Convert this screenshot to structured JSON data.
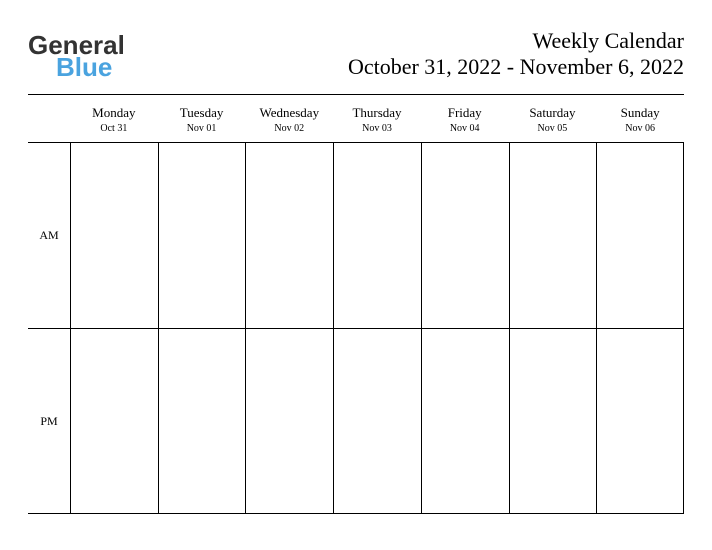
{
  "brand": {
    "word1": "General",
    "word2": "Blue"
  },
  "title": "Weekly Calendar",
  "date_range": "October 31, 2022 - November 6, 2022",
  "days": [
    {
      "name": "Monday",
      "date": "Oct 31"
    },
    {
      "name": "Tuesday",
      "date": "Nov 01"
    },
    {
      "name": "Wednesday",
      "date": "Nov 02"
    },
    {
      "name": "Thursday",
      "date": "Nov 03"
    },
    {
      "name": "Friday",
      "date": "Nov 04"
    },
    {
      "name": "Saturday",
      "date": "Nov 05"
    },
    {
      "name": "Sunday",
      "date": "Nov 06"
    }
  ],
  "time_labels": {
    "am": "AM",
    "pm": "PM"
  }
}
